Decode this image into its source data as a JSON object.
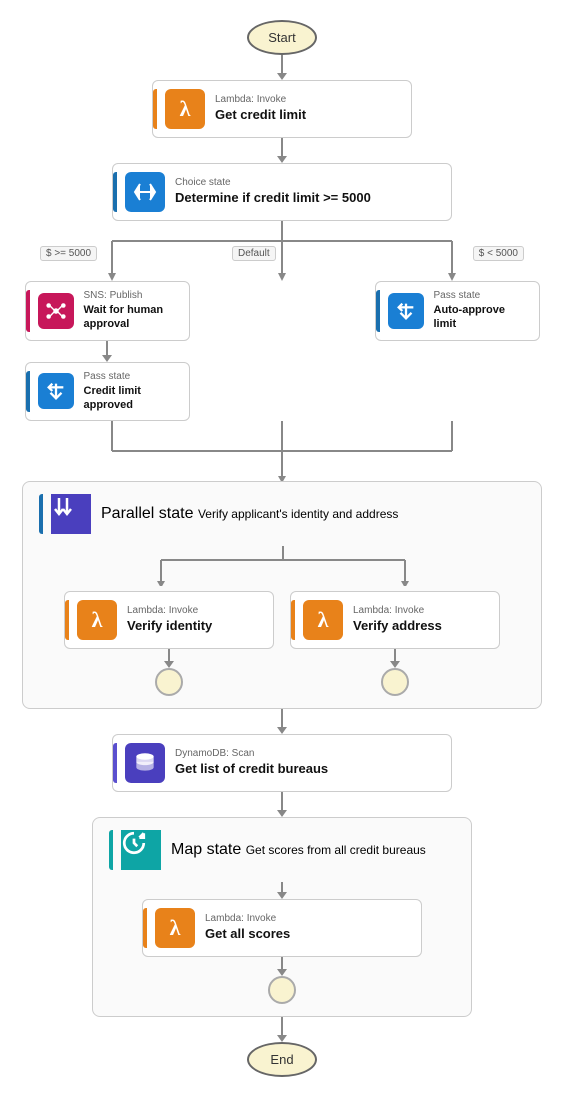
{
  "nodes": {
    "start": "Start",
    "end": "End"
  },
  "cards": {
    "get_credit_limit": {
      "label_top": "Lambda: Invoke",
      "label_main": "Get credit limit",
      "bar_color": "bar-orange",
      "icon_color": "icon-orange",
      "icon": "λ"
    },
    "choice_state": {
      "label_top": "Choice state",
      "label_main": "Determine if credit limit >= 5000",
      "bar_color": "bar-blue",
      "icon_color": "icon-blue",
      "icon": "⇄"
    },
    "wait_human": {
      "label_top": "SNS: Publish",
      "label_main": "Wait for human approval",
      "bar_color": "bar-pink",
      "icon_color": "icon-pink",
      "icon": "❋"
    },
    "credit_approved": {
      "label_top": "Pass state",
      "label_main": "Credit limit approved",
      "bar_color": "bar-blue",
      "icon_color": "icon-blue",
      "icon": "⇓"
    },
    "auto_approve": {
      "label_top": "Pass state",
      "label_main": "Auto-approve limit",
      "bar_color": "bar-blue",
      "icon_color": "icon-blue",
      "icon": "⇓"
    },
    "parallel_state": {
      "label_top": "Parallel state",
      "label_main": "Verify applicant's identity and address",
      "bar_color": "bar-blue",
      "icon_color": "icon-indigo",
      "icon": "⇊"
    },
    "verify_identity": {
      "label_top": "Lambda: Invoke",
      "label_main": "Verify identity",
      "bar_color": "bar-orange",
      "icon_color": "icon-orange",
      "icon": "λ"
    },
    "verify_address": {
      "label_top": "Lambda: Invoke",
      "label_main": "Verify address",
      "bar_color": "bar-orange",
      "icon_color": "icon-orange",
      "icon": "λ"
    },
    "dynamo_scan": {
      "label_top": "DynamoDB: Scan",
      "label_main": "Get list of credit bureaus",
      "bar_color": "bar-indigo",
      "icon_color": "icon-indigo",
      "icon": "🗄"
    },
    "map_state": {
      "label_top": "Map state",
      "label_main": "Get scores from all credit bureaus",
      "bar_color": "bar-teal",
      "icon_color": "icon-teal",
      "icon": "↻"
    },
    "get_all_scores": {
      "label_top": "Lambda: Invoke",
      "label_main": "Get all scores",
      "bar_color": "bar-orange",
      "icon_color": "icon-orange",
      "icon": "λ"
    }
  },
  "branch_labels": {
    "gte5000": "$ >= 5000",
    "default": "Default",
    "lt5000": "$ < 5000"
  }
}
